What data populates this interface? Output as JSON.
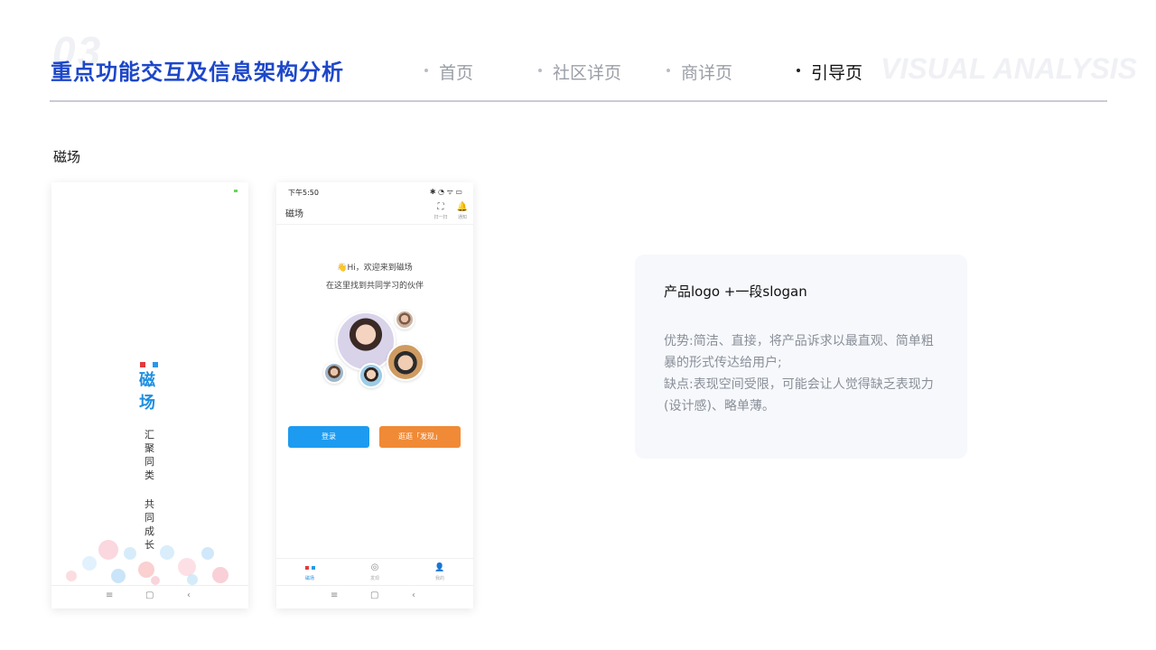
{
  "header": {
    "section_number": "03",
    "title": "重点功能交互及信息架构分析",
    "watermark": "VISUAL ANALYSIS",
    "nav": [
      {
        "label": "首页",
        "active": false
      },
      {
        "label": "社区详页",
        "active": false
      },
      {
        "label": "商详页",
        "active": false
      },
      {
        "label": "引导页",
        "active": true
      }
    ]
  },
  "section_label": "磁场",
  "splash": {
    "logo_chars": [
      "磁",
      "场"
    ],
    "slogan_line1": [
      "汇",
      "聚",
      "同",
      "类"
    ],
    "slogan_line2": [
      "共",
      "同",
      "成",
      "长"
    ],
    "sys_nav": [
      "≡",
      "▢",
      "‹"
    ]
  },
  "guide": {
    "status_time": "下午5:50",
    "status_icons": "✱ ◔ ᯤ ▭",
    "app_title": "磁场",
    "scan_icon": "⛶",
    "scan_label": "扫一扫",
    "bell_icon": "🔔",
    "bell_label": "通知",
    "greeting": "👋Hi，欢迎来到磁场",
    "tagline": "在这里找到共同学习的伙伴",
    "login_label": "登录",
    "browse_label": "逛逛「发现」",
    "tabs": [
      {
        "icon": "▪▪",
        "label": "磁场"
      },
      {
        "icon": "◎",
        "label": "发现"
      },
      {
        "icon": "👤",
        "label": "我的"
      }
    ],
    "sys_nav": [
      "≡",
      "▢",
      "‹"
    ]
  },
  "card": {
    "title": "产品logo +一段slogan",
    "advantage": "优势:简洁、直接，将产品诉求以最直观、简单粗暴的形式传达给用户;",
    "disadvantage": "缺点:表现空间受限，可能会让人觉得缺乏表现力(设计感)、略单薄。"
  },
  "colors": {
    "title_blue": "#1d47c9",
    "login_blue": "#1d9bf0",
    "browse_orange": "#f08a36"
  }
}
